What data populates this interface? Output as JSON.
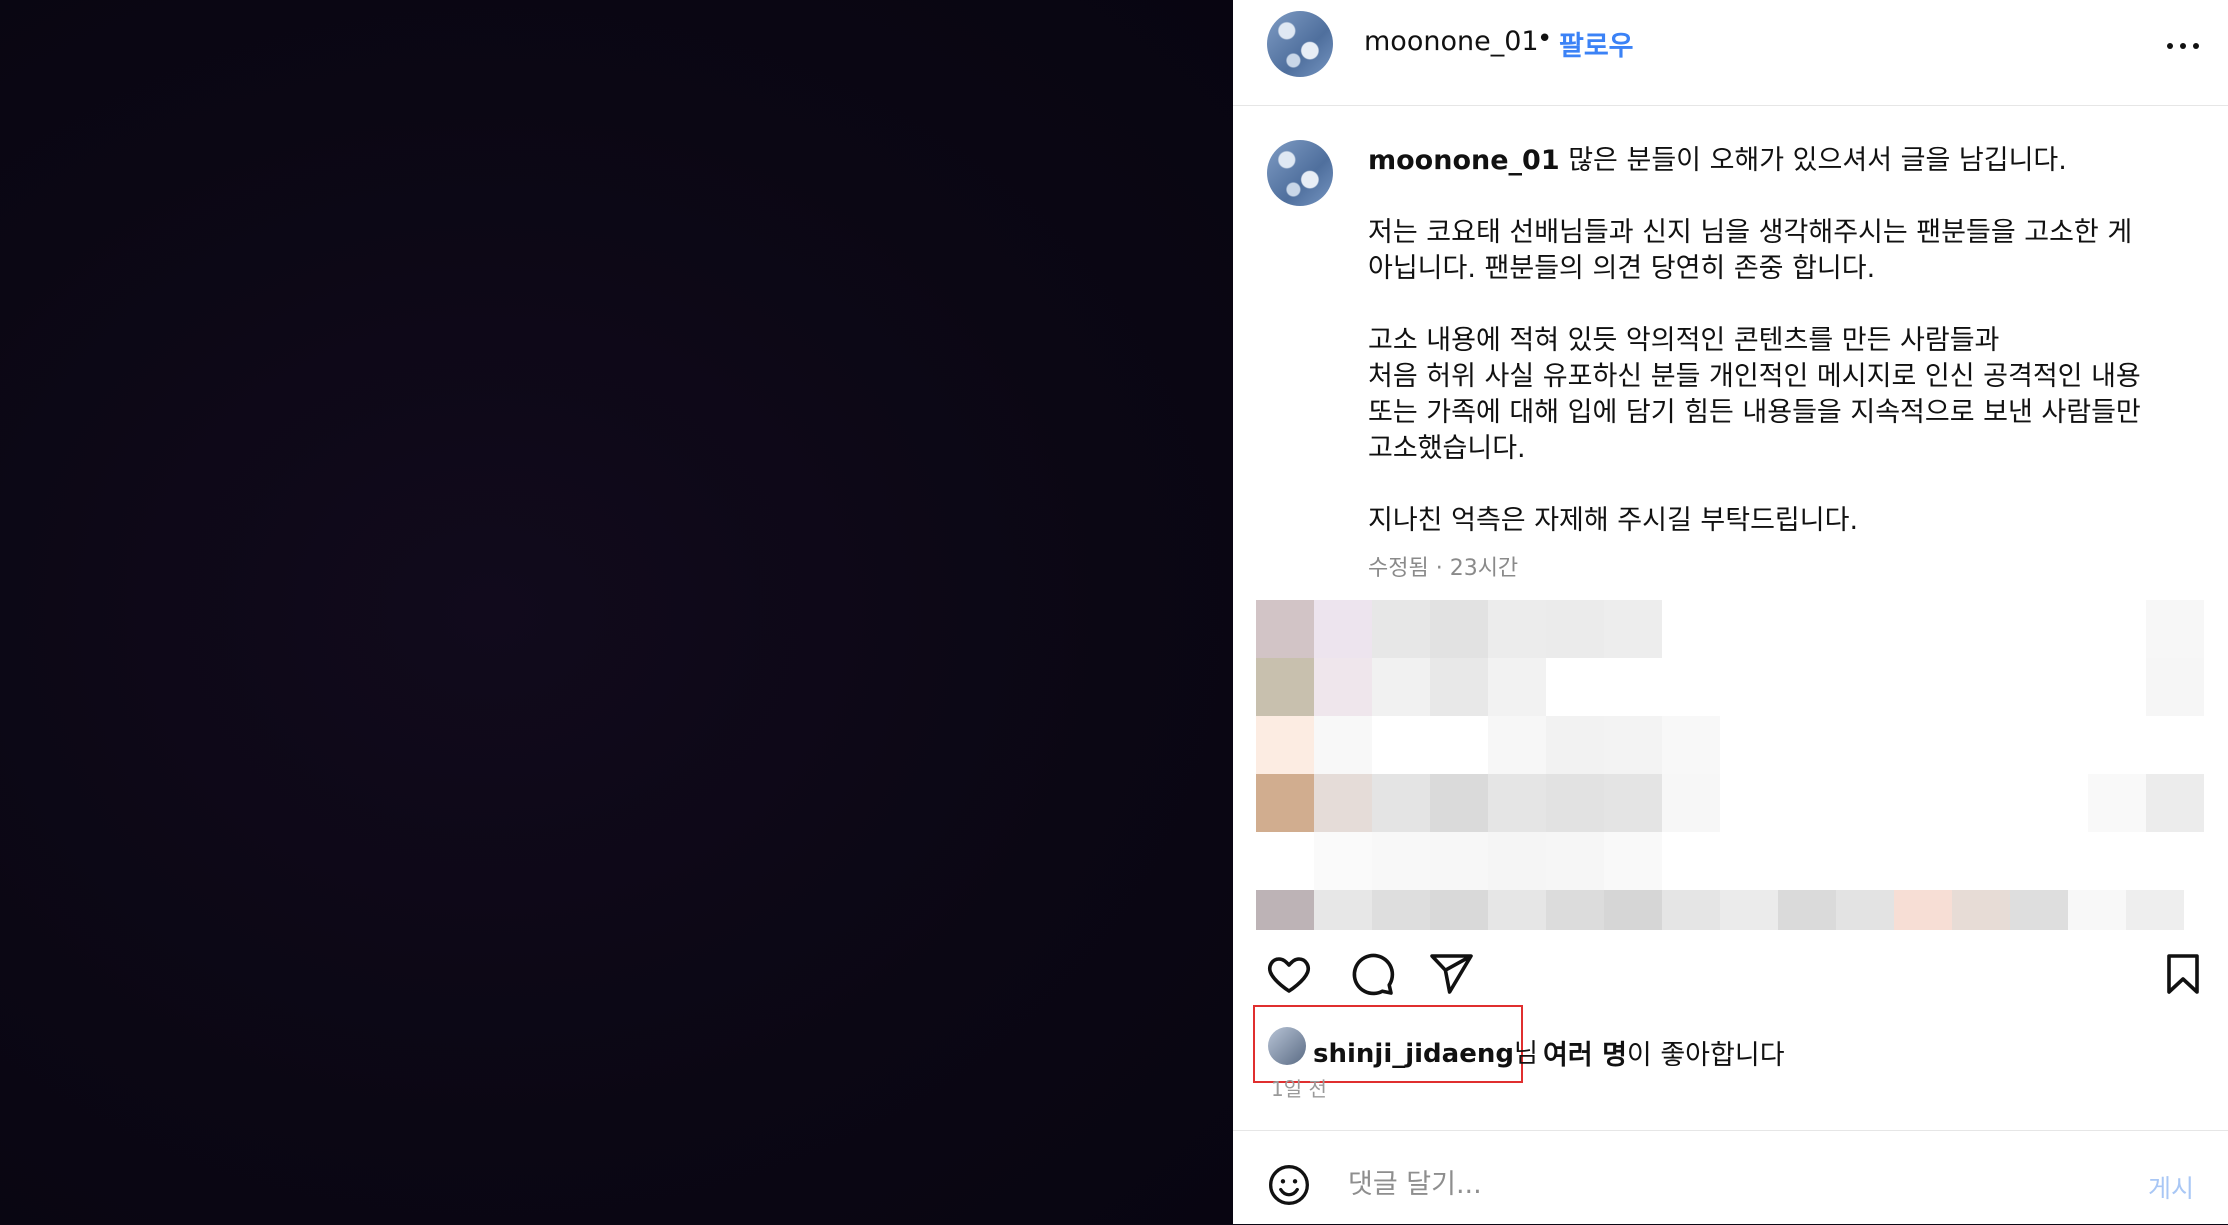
{
  "post_media": {
    "icon": "dark-image"
  },
  "header": {
    "username": "moonone_01",
    "separator": "•",
    "follow_label": "팔로우",
    "more_icon": "more-horizontal-icon"
  },
  "caption": {
    "username": "moonone_01",
    "first_line": "많은 분들이 오해가 있으셔서 글을 남깁니다.",
    "lines": [
      "저는 코요태 선배님들과 신지 님을 생각해주시는 팬분들을 고소한 게",
      "아닙니다. 팬분들의 의견 당연히 존중 합니다.",
      "고소 내용에 적혀 있듯 악의적인 콘텐츠를 만든 사람들과",
      "처음 허위 사실 유포하신 분들 개인적인 메시지로 인신 공격적인 내용",
      "또는 가족에 대해 입에 담기 힘든 내용들을 지속적으로 보낸 사람들만",
      "고소했습니다.",
      "지나친 억측은 자제해 주시길 부탁드립니다."
    ],
    "meta": "수정됨 · 23시간"
  },
  "actions": {
    "like_icon": "heart-icon",
    "comment_icon": "comment-bubble-icon",
    "share_icon": "send-icon",
    "save_icon": "bookmark-icon"
  },
  "likes": {
    "user": "shinji_jidaeng",
    "user_suffix": "님",
    "others": "여러 명",
    "tail": "이 좋아합니다",
    "time_ago": "1일 전"
  },
  "comment": {
    "placeholder": "댓글 달기...",
    "post_label": "게시",
    "emoji_icon": "smiley-icon"
  },
  "colors": {
    "accent": "#3b82f6",
    "post_disabled": "#a9c7f5",
    "highlight_box": "#e02f2f",
    "media_bg": "#0b0714"
  }
}
